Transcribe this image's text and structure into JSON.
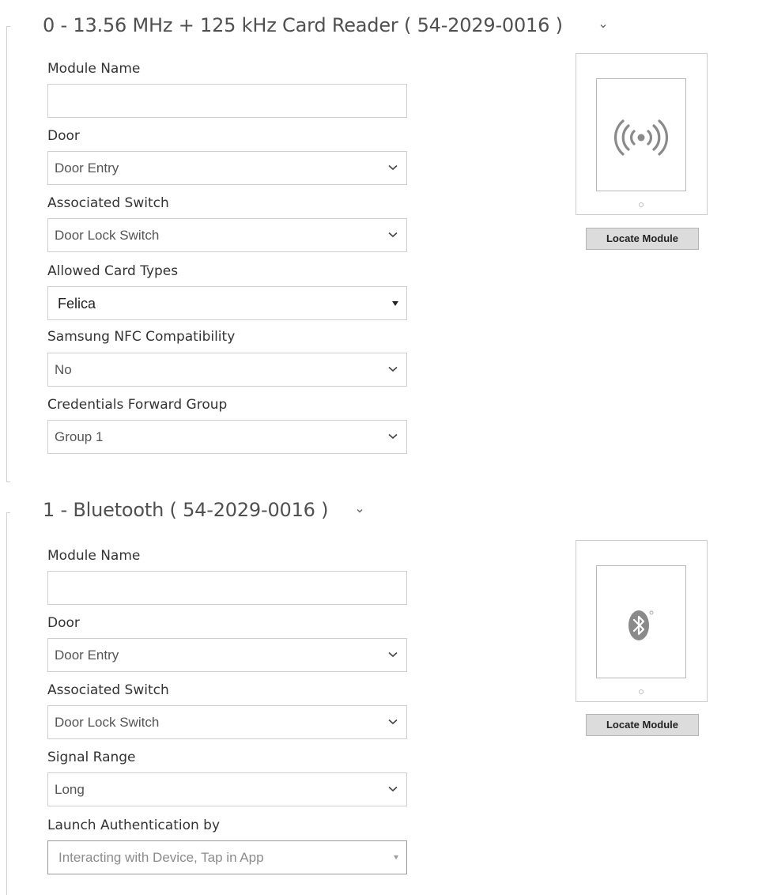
{
  "modules": [
    {
      "title": "0 - 13.56 MHz + 125 kHz Card Reader ( 54-2029-0016 )",
      "fields": [
        {
          "label": "Module Name",
          "type": "text",
          "value": ""
        },
        {
          "label": "Door",
          "type": "select",
          "value": "Door Entry"
        },
        {
          "label": "Associated Switch",
          "type": "select",
          "value": "Door Lock Switch"
        },
        {
          "label": "Allowed Card Types",
          "type": "native-select",
          "value": "Felica"
        },
        {
          "label": "Samsung NFC Compatibility",
          "type": "select",
          "value": "No"
        },
        {
          "label": "Credentials Forward Group",
          "type": "select",
          "value": "Group 1"
        }
      ],
      "preview_icon": "nfc-wave-icon",
      "locate_label": "Locate Module"
    },
    {
      "title": "1 - Bluetooth ( 54-2029-0016 )",
      "fields": [
        {
          "label": "Module Name",
          "type": "text",
          "value": ""
        },
        {
          "label": "Door",
          "type": "select",
          "value": "Door Entry"
        },
        {
          "label": "Associated Switch",
          "type": "select",
          "value": "Door Lock Switch"
        },
        {
          "label": "Signal Range",
          "type": "select",
          "value": "Long"
        },
        {
          "label": "Launch Authentication by",
          "type": "disabled-select",
          "value": "Interacting with Device, Tap in App"
        }
      ],
      "preview_icon": "bluetooth-icon",
      "locate_label": "Locate Module"
    }
  ],
  "colors": {
    "field_border": "#cfcfcf",
    "button_bg": "#dcdcdc",
    "icon_grey": "#8a8a8a"
  }
}
